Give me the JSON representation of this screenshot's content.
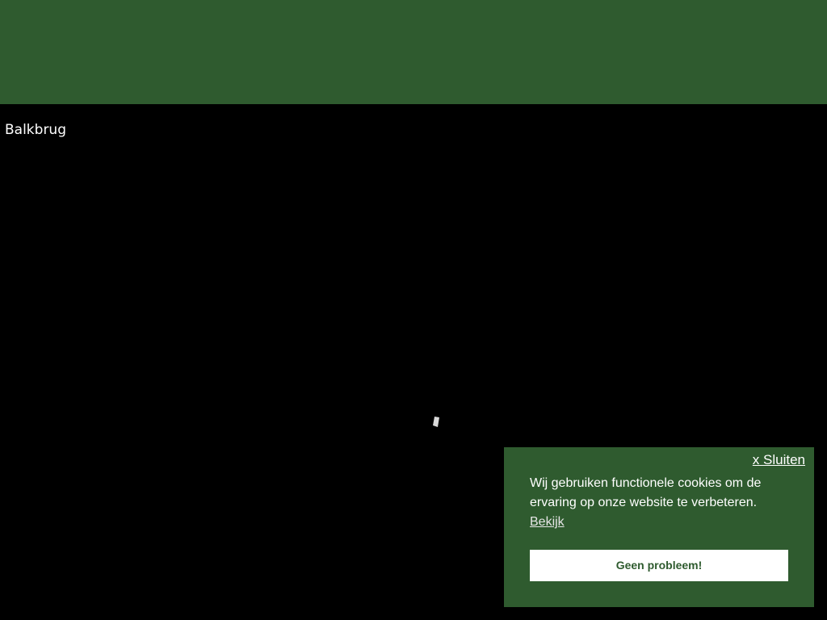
{
  "header": {
    "background_color": "#2f5b2f"
  },
  "map": {
    "place_label": "Balkbrug",
    "loading_icon": "spinner-icon"
  },
  "cookie_notice": {
    "close_label": "x Sluiten",
    "message": "Wij gebruiken functionele cookies om de ervaring op onze website te verbeteren.",
    "learn_more_label": "Bekijk",
    "accept_label": "Geen probleem!",
    "background_color": "#2f5b2f",
    "button_text_color": "#2f5b2f"
  }
}
